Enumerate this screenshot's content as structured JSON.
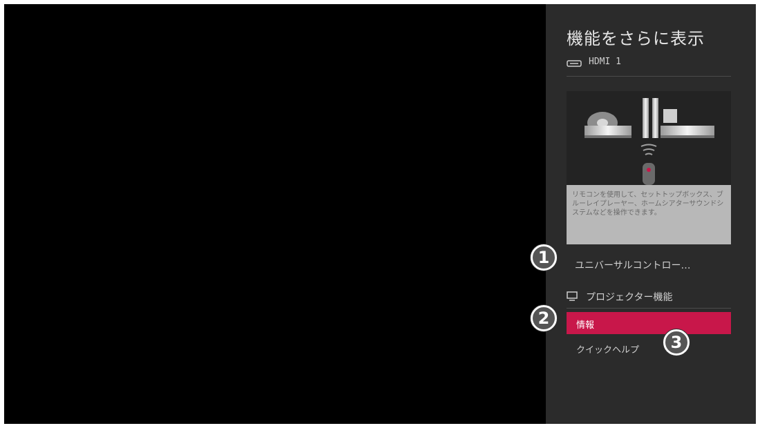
{
  "panel": {
    "title": "機能をさらに表示",
    "source": {
      "icon": "hdmi-icon",
      "label": "HDMI 1"
    },
    "illustration": {
      "icon": "home-devices-remote-illustration"
    },
    "description": "リモコンを使用して、セットトップボックス、ブルーレイプレーヤー、ホームシアターサウンドシステムなどを操作できます。",
    "universal_control": {
      "label": "ユニバーサルコントロー…"
    },
    "projector_section": {
      "icon": "monitor-icon",
      "label": "プロジェクター機能"
    },
    "items": [
      {
        "label": "情報",
        "selected": true
      },
      {
        "label": "クイックヘルプ",
        "selected": false
      }
    ],
    "selected_color": "#c8174a"
  },
  "callouts": [
    "1",
    "2",
    "3"
  ]
}
